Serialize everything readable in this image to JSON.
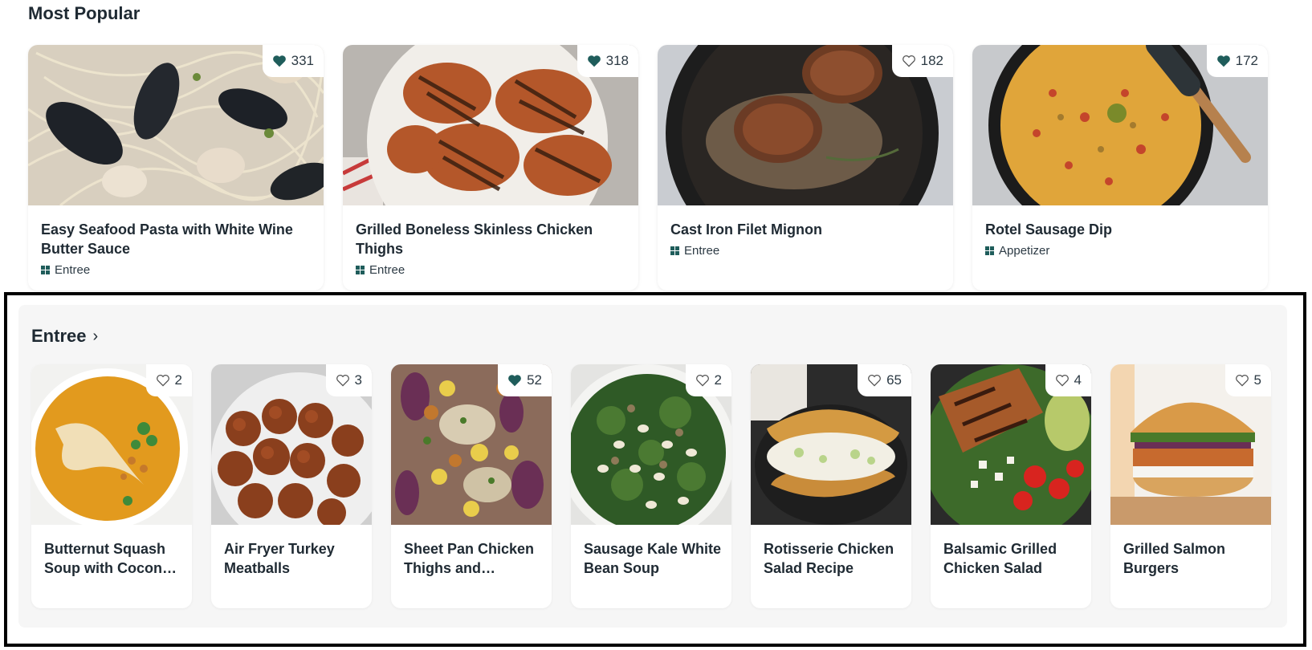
{
  "most_popular": {
    "title": "Most Popular",
    "cards": [
      {
        "title": "Easy Seafood Pasta with White Wine Butter Sauce",
        "likes": "331",
        "liked": true,
        "category": "Entree"
      },
      {
        "title": "Grilled Boneless Skinless Chicken Thighs",
        "likes": "318",
        "liked": true,
        "category": "Entree"
      },
      {
        "title": "Cast Iron Filet Mignon",
        "likes": "182",
        "liked": false,
        "category": "Entree"
      },
      {
        "title": "Rotel Sausage Dip",
        "likes": "172",
        "liked": true,
        "category": "Appetizer"
      }
    ]
  },
  "entree": {
    "title": "Entree",
    "chevron": "›",
    "cards": [
      {
        "title": "Butternut Squash Soup with Cocon…",
        "likes": "2",
        "liked": false
      },
      {
        "title": "Air Fryer Turkey Meatballs",
        "likes": "3",
        "liked": false
      },
      {
        "title": "Sheet Pan Chicken Thighs and…",
        "likes": "52",
        "liked": true
      },
      {
        "title": "Sausage Kale White Bean Soup",
        "likes": "2",
        "liked": false
      },
      {
        "title": "Rotisserie Chicken Salad Recipe",
        "likes": "65",
        "liked": false
      },
      {
        "title": "Balsamic Grilled Chicken Salad",
        "likes": "4",
        "liked": false
      },
      {
        "title": "Grilled Salmon Burgers",
        "likes": "5",
        "liked": false
      }
    ]
  },
  "colors": {
    "accent": "#1f5d5b",
    "text": "#1f2a33",
    "section_bg": "#f6f6f6"
  }
}
